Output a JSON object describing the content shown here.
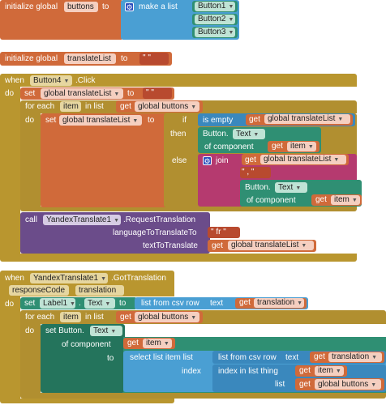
{
  "block1": {
    "init_label": "initialize global",
    "var_name": "buttons",
    "to_label": "to",
    "make_list_label": "make a list",
    "items": [
      "Button1",
      "Button2",
      "Button3"
    ]
  },
  "block2": {
    "init_label": "initialize global",
    "var_name": "translateList",
    "to_label": "to",
    "empty_string": " \" \" "
  },
  "block3": {
    "when_label": "when",
    "component": "Button4",
    "event": ".Click",
    "do_label": "do",
    "set_label": "set",
    "set_var": "global translateList",
    "to_label": "to",
    "empty_string": " \" \" ",
    "for_each_label": "for each",
    "item_var": "item",
    "in_list_label": "in list",
    "get_label": "get",
    "get_buttons": "global buttons",
    "inner_do_label": "do",
    "inner_set_label": "set",
    "inner_set_var": "global translateList",
    "inner_to_label": "to",
    "if_label": "if",
    "is_empty_label": "is empty",
    "get_translate": "global translateList",
    "then_label": "then",
    "button_label": "Button.",
    "text_prop": "Text",
    "of_component_label": "of component",
    "get_item": "item",
    "else_label": "else",
    "join_label": "join",
    "comma_string": " \" , \" ",
    "call_label": "call",
    "call_component": "YandexTranslate1",
    "call_method": ".RequestTranslation",
    "lang_label": "languageToTranslateTo",
    "lang_value": " \" fr \" ",
    "text_to_translate_label": "textToTranslate"
  },
  "block4": {
    "when_label": "when",
    "component": "YandexTranslate1",
    "event": ".GotTranslation",
    "param1": "responseCode",
    "param2": "translation",
    "do_label": "do",
    "set_label": "set",
    "label_component": "Label1",
    "text_prop": "Text",
    "to_label": "to",
    "list_from_csv_row": "list from csv row",
    "text_label": "text",
    "get_label": "get",
    "translation_var": "translation",
    "for_each_label": "for each",
    "item_var": "item",
    "in_list_label": "in list",
    "get_buttons": "global buttons",
    "inner_do_label": "do",
    "set_button_label": "set Button.",
    "of_component_label": "of component",
    "get_item": "item",
    "select_list_item": "select list item  list",
    "index_label": "index",
    "index_in_list": "index in list  thing",
    "list_label": "list",
    "period": "."
  }
}
